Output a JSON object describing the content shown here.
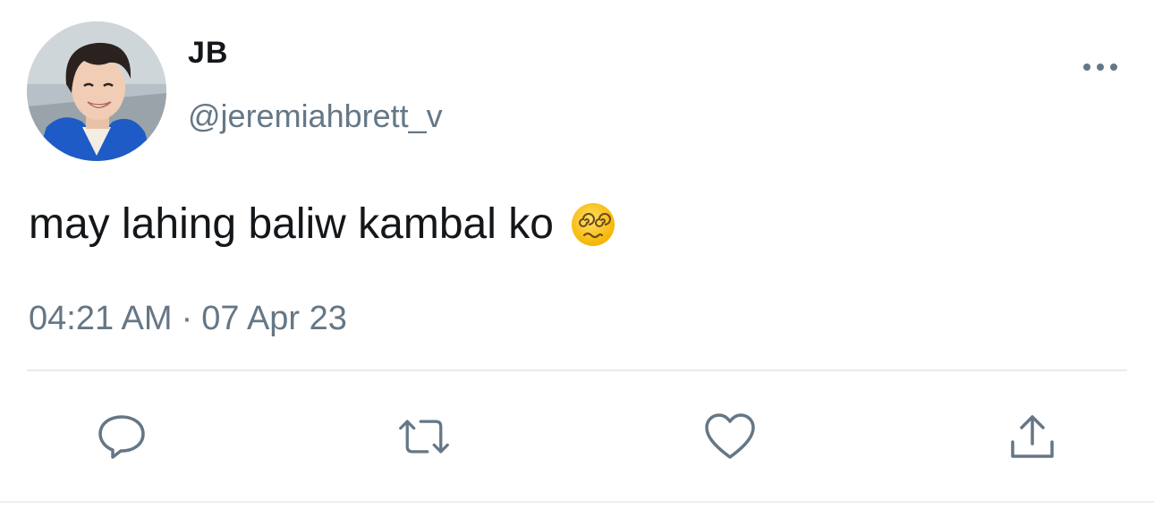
{
  "tweet": {
    "author": {
      "display_name": "JB",
      "handle": "@jeremiahbrett_v",
      "avatar_icon": "profile-photo"
    },
    "text": "may lahing baliw kambal ko",
    "emoji": "face-with-spiral-eyes",
    "time": "04:21 AM",
    "separator": "·",
    "date": "07 Apr 23"
  },
  "actions": {
    "reply_icon": "speech-bubble-icon",
    "retweet_icon": "retweet-icon",
    "like_icon": "heart-icon",
    "share_icon": "share-upload-icon",
    "more_icon": "ellipsis-icon"
  },
  "colors": {
    "text_primary": "#14171a",
    "text_secondary": "#657786",
    "icon": "#657786",
    "divider": "#e6ecf0"
  }
}
